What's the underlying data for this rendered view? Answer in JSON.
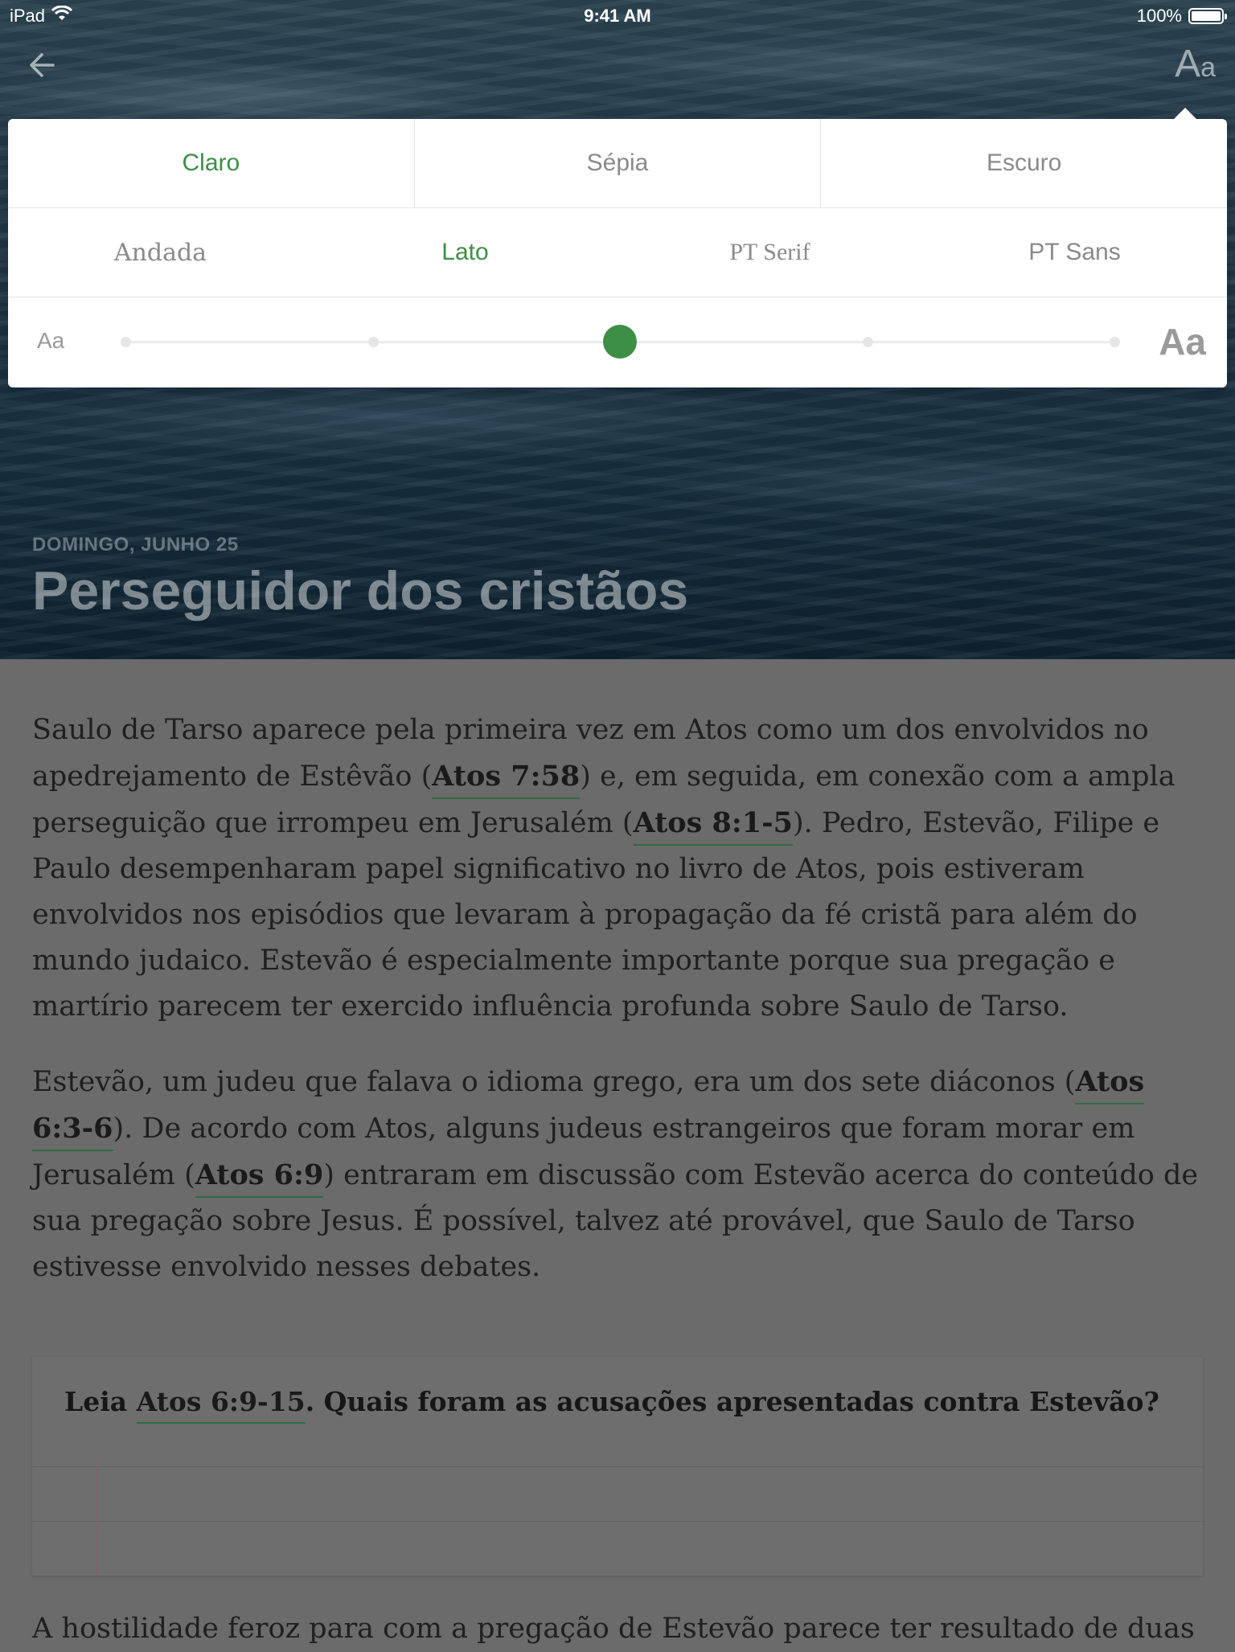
{
  "status_bar": {
    "device": "iPad",
    "time": "9:41 AM",
    "battery": "100%",
    "battery_level": 1.0
  },
  "nav": {
    "font_button_big": "A",
    "font_button_small": "a"
  },
  "reader_settings": {
    "themes": [
      {
        "label": "Claro",
        "selected": true
      },
      {
        "label": "Sépia",
        "selected": false
      },
      {
        "label": "Escuro",
        "selected": false
      }
    ],
    "fonts": [
      {
        "label": "Andada",
        "selected": false
      },
      {
        "label": "Lato",
        "selected": true
      },
      {
        "label": "PT Serif",
        "selected": false
      },
      {
        "label": "PT Sans",
        "selected": false
      }
    ],
    "size_small_label": "Aa",
    "size_large_label": "Aa",
    "size_steps": 5,
    "size_selected_index": 2,
    "accent_color": "#3c8f45"
  },
  "lesson": {
    "date": "DOMINGO, JUNHO 25",
    "title": "Perseguidor dos cristãos"
  },
  "content": {
    "p1": {
      "t1": "Saulo de Tarso aparece pela primeira vez em Atos como um dos envolvidos no apedrejamento de Estêvão (",
      "r1": "Atos 7:58",
      "t2": ") e, em seguida, em conexão com a ampla perseguição que irrompeu em Jerusalém (",
      "r2": "Atos 8:1-5",
      "t3": "). Pedro, Estevão, Filipe e Paulo desempenharam papel significativo no livro de Atos, pois estiveram envolvidos nos episódios que levaram à propagação da fé cristã para além do mundo judaico. Estevão é especialmente importante porque sua pregação e martírio parecem ter exercido influência profunda sobre Saulo de Tarso."
    },
    "p2": {
      "t1": "Estevão, um judeu que falava o idioma grego, era um dos sete diáconos (",
      "r1": "Atos 6:3-6",
      "t2": "). De acordo com Atos, alguns judeus estrangeiros que foram morar em Jerusalém (",
      "r2": "Atos 6:9",
      "t3": ") entraram em discussão com Estevão acerca do conteúdo de sua pregação sobre Jesus. É possível, talvez até provável, que Saulo de Tarso estivesse envolvido nesses debates."
    },
    "question": {
      "t1": "Leia ",
      "r1": "Atos 6:9-15",
      "t2": ". Quais foram as acusações apresentadas contra Estevão?"
    },
    "p3_partial": "A hostilidade feroz para com a pregação de Estevão parece ter resultado de duas"
  }
}
